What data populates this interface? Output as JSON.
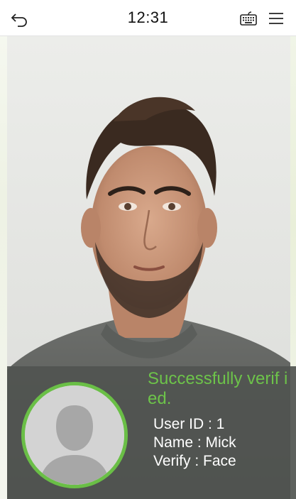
{
  "status_bar": {
    "time": "12:31",
    "icons": {
      "back": "back-arrow-icon",
      "keyboard": "keyboard-icon",
      "menu": "hamburger-menu-icon"
    }
  },
  "verification": {
    "message": "Successfully verif ied.",
    "user_id": "User ID : 1",
    "name": "Name : Mick",
    "verify": "Verify : Face"
  },
  "colors": {
    "success_green": "#6abf46",
    "overlay_bg": "#505450",
    "text_white": "#ffffff"
  }
}
